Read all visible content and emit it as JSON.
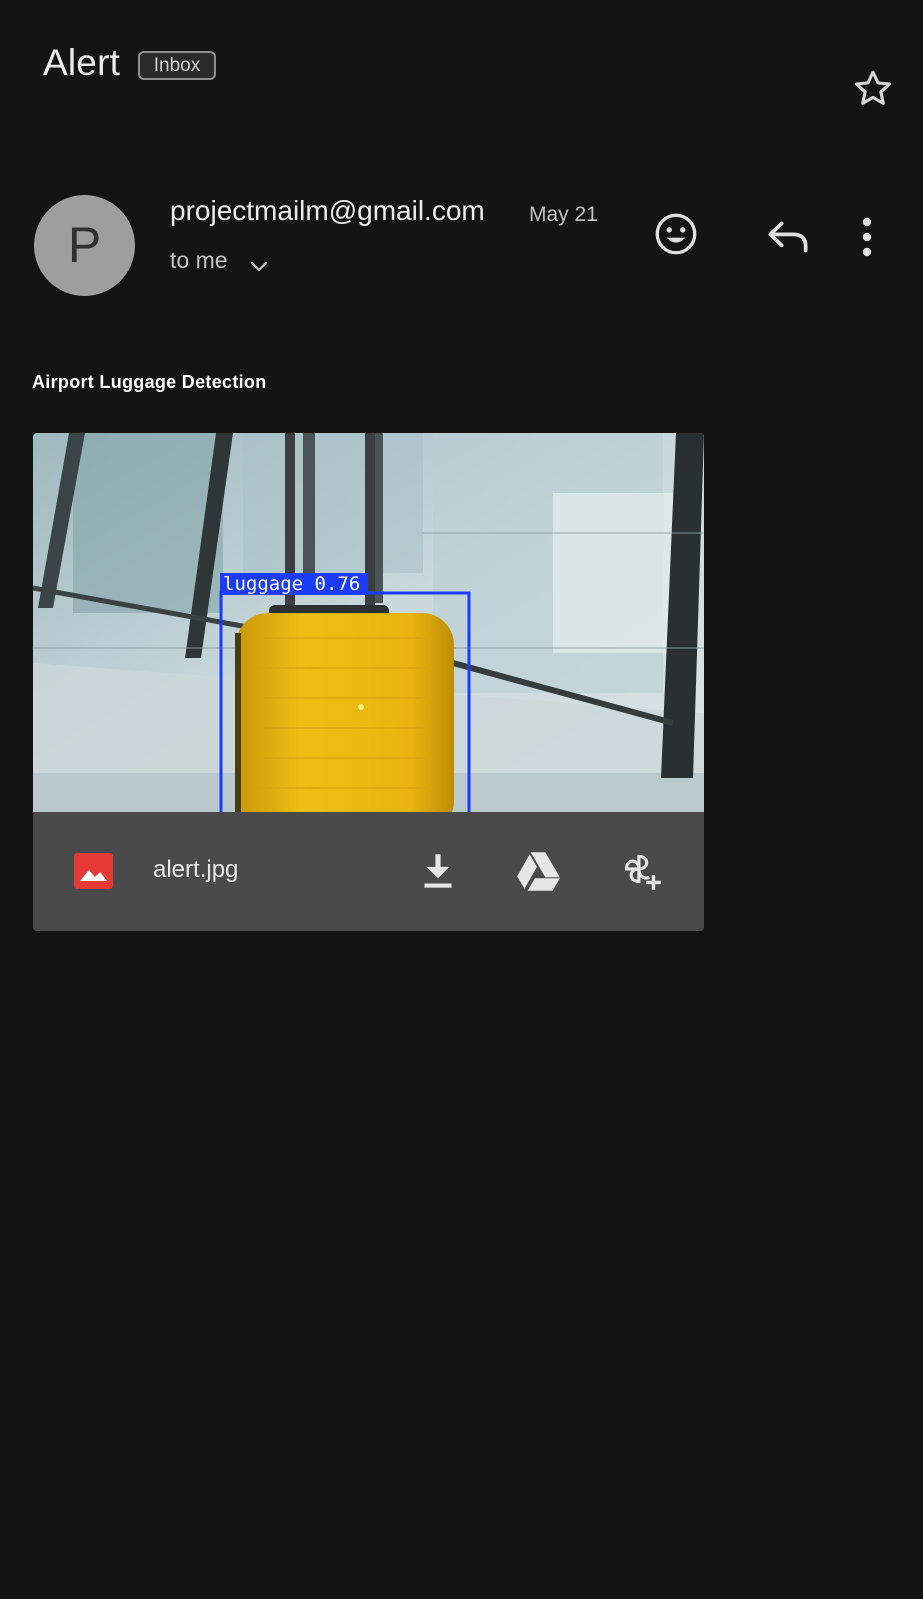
{
  "header": {
    "subject": "Alert",
    "label": "Inbox",
    "star_icon": "star-outline-icon"
  },
  "message": {
    "avatar_initial": "P",
    "sender": "projectmailm@gmail.com",
    "date": "May 21",
    "recipient": "to me",
    "actions": {
      "emoji_icon": "emoji-react-icon",
      "reply_icon": "reply-icon",
      "more_icon": "more-vert-icon"
    },
    "body_title": "Airport Luggage Detection"
  },
  "attachment": {
    "detection_label": "luggage 0.76",
    "file_name": "alert.jpg",
    "file_type_icon": "image-file-icon",
    "actions": [
      "download-icon",
      "drive-icon",
      "add-to-photos-icon"
    ]
  },
  "colors": {
    "background": "#141414",
    "card_footer": "#4a4a4a",
    "detection_box": "#1a3cff",
    "luggage": "#e8b512",
    "file_icon": "#e53935"
  }
}
